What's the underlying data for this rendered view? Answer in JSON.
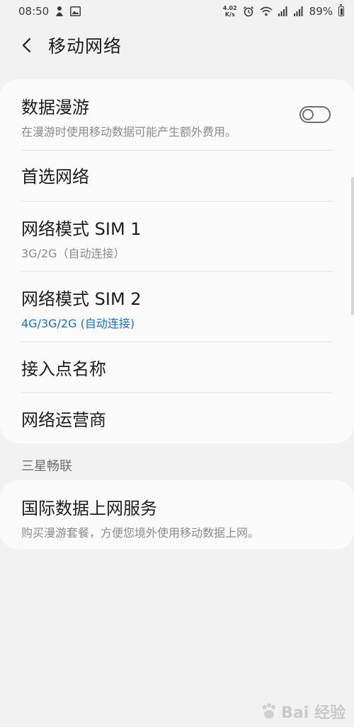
{
  "status_bar": {
    "time": "08:50",
    "net_speed_value": "4.02",
    "net_speed_unit": "K/s",
    "battery": "89%",
    "icons": [
      "notification-icon",
      "image-icon",
      "alarm-icon",
      "wifi-icon",
      "signal-icon",
      "4g-signal-icon",
      "battery-icon"
    ]
  },
  "app_bar": {
    "title": "移动网络"
  },
  "settings": {
    "data_roaming": {
      "title": "数据漫游",
      "subtitle": "在漫游时使用移动数据可能产生额外费用。",
      "enabled": false
    },
    "preferred_network": {
      "title": "首选网络"
    },
    "network_mode_sim1": {
      "title": "网络模式 SIM 1",
      "subtitle": "3G/2G（自动连接）"
    },
    "network_mode_sim2": {
      "title": "网络模式 SIM 2",
      "subtitle": "4G/3G/2G (自动连接)"
    },
    "apn": {
      "title": "接入点名称"
    },
    "network_operator": {
      "title": "网络运营商"
    }
  },
  "section_samsung": {
    "header": "三星畅联",
    "international_data": {
      "title": "国际数据上网服务",
      "subtitle": "购买漫游套餐，方便您境外使用移动数据上网。"
    }
  },
  "watermark": {
    "text": "Bai  经验"
  },
  "colors": {
    "background": "#f2f2f2",
    "card": "#fbfbfb",
    "accent": "#1a6fc4",
    "subtitle": "#8a8a8a"
  }
}
